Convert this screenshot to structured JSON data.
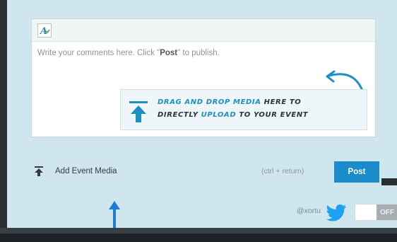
{
  "editor": {
    "placeholder_prefix": "Write your comments here. Click \"",
    "placeholder_bold": "Post",
    "placeholder_suffix": "\" to publish.",
    "format_icon": "text-format-icon"
  },
  "drop_hint": {
    "line1_a": "Drag and Drop Media",
    "line1_b": " here to",
    "line2_a": "directly ",
    "line2_b": "upload",
    "line2_c": " to your event",
    "accent_color": "#1e8fc2"
  },
  "footer": {
    "add_media_label": "Add Event Media",
    "shortcut_hint": "(ctrl + return)",
    "post_label": "Post",
    "twitter_handle": "@xortu",
    "toggle_state": "OFF",
    "post_color": "#1a8cc9"
  }
}
